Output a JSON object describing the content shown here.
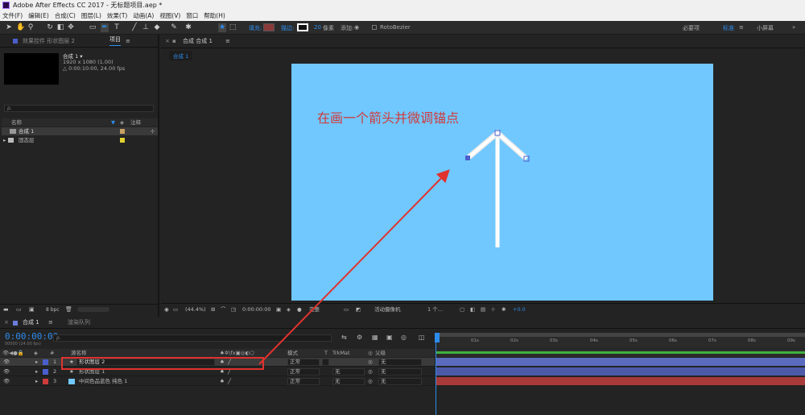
{
  "titlebar": {
    "title": "Adobe After Effects CC 2017 - 无标题项目.aep *"
  },
  "menu": [
    "文件(F)",
    "编辑(E)",
    "合成(C)",
    "图层(L)",
    "效果(T)",
    "动画(A)",
    "视图(V)",
    "窗口",
    "帮助(H)"
  ],
  "toolbar": {
    "fill_label": "填充:",
    "stroke_label": "描边:",
    "stroke_width": "20",
    "stroke_unit": "像素",
    "add_label": "添加:",
    "rotobezier_label": "RotoBezier",
    "fill_color": "#8a3a3a",
    "workspace_default": "必要项",
    "workspace_standard": "标准",
    "workspace_small": "小屏幕"
  },
  "project": {
    "tab_effects": "效果控件 形状图层 2",
    "tab_project": "项目",
    "comp_name": "合成 1 ▾",
    "comp_res": "1920 x 1080 (1.00)",
    "comp_dur": "△ 0:00:10:00, 24.00 fps",
    "search_placeholder": "ρ.",
    "col_name": "名称",
    "col_comment": "注释",
    "items": [
      {
        "name": "合成 1",
        "color": "#c8a264"
      },
      {
        "name": "固态层",
        "color": "#e0d030"
      }
    ],
    "bpc": "8 bpc"
  },
  "composition": {
    "tab_label": "合成 合成 1",
    "subtab_label": "合成 1",
    "canvas_text": "在画一个箭头并微调锚点",
    "bg_color": "#70c8ff",
    "bottom": {
      "zoom": "(44.4%)",
      "time": "0:00:00:00",
      "quality": "完整",
      "camera": "活动摄像机",
      "views": "1 个...",
      "exposure": "+0.0"
    }
  },
  "timeline": {
    "tab_comp": "合成 1",
    "tab_render": "渲染队列",
    "timecode": "0:00:00:00",
    "timecode_sub": "00000 (24.00 fps)",
    "search_placeholder": "ρ.",
    "col_source": "源名称",
    "col_mode": "模式",
    "col_t": "T",
    "col_trkmat": "TrkMat",
    "col_parent": "父级",
    "layers": [
      {
        "num": "1",
        "name": "形状图层 2",
        "mode": "正常",
        "trkmat": "",
        "parent": "无",
        "color": "#4a5fcc"
      },
      {
        "num": "2",
        "name": "形状图层 1",
        "mode": "正常",
        "trkmat": "无",
        "parent": "无",
        "color": "#4a5fcc"
      },
      {
        "num": "3",
        "name": "中间色品蓝色 纯色 1",
        "mode": "正常",
        "trkmat": "无",
        "parent": "无",
        "color": "#d03b3b"
      }
    ],
    "ruler_ticks": [
      "01s",
      "02s",
      "03s",
      "04s",
      "05s",
      "06s",
      "07s",
      "08s",
      "09s"
    ]
  }
}
